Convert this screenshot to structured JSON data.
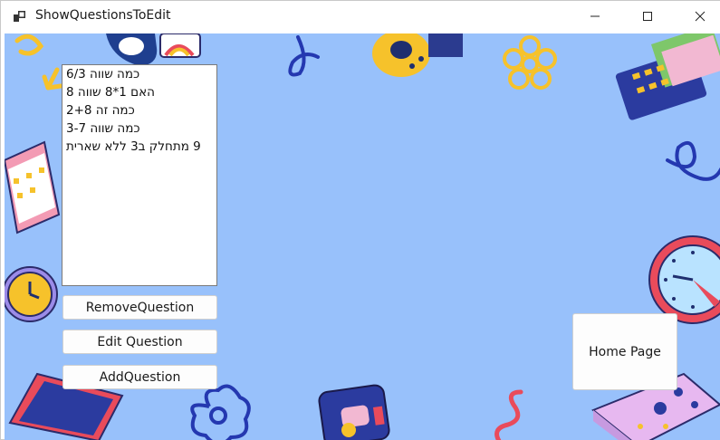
{
  "window": {
    "title": "ShowQuestionsToEdit"
  },
  "questions_list": {
    "items": [
      "כמה שווה 6/3",
      "האם 1*8 שווה 8",
      "כמה זה 2+8",
      "כמה שווה 3-7",
      "9 מתחלק ב3 ללא שארית"
    ]
  },
  "buttons": {
    "remove_label": "RemoveQuestion",
    "edit_label": "Edit Question",
    "add_label": "AddQuestion",
    "home_label": "Home Page"
  },
  "colors": {
    "background": "#98c1fb"
  }
}
